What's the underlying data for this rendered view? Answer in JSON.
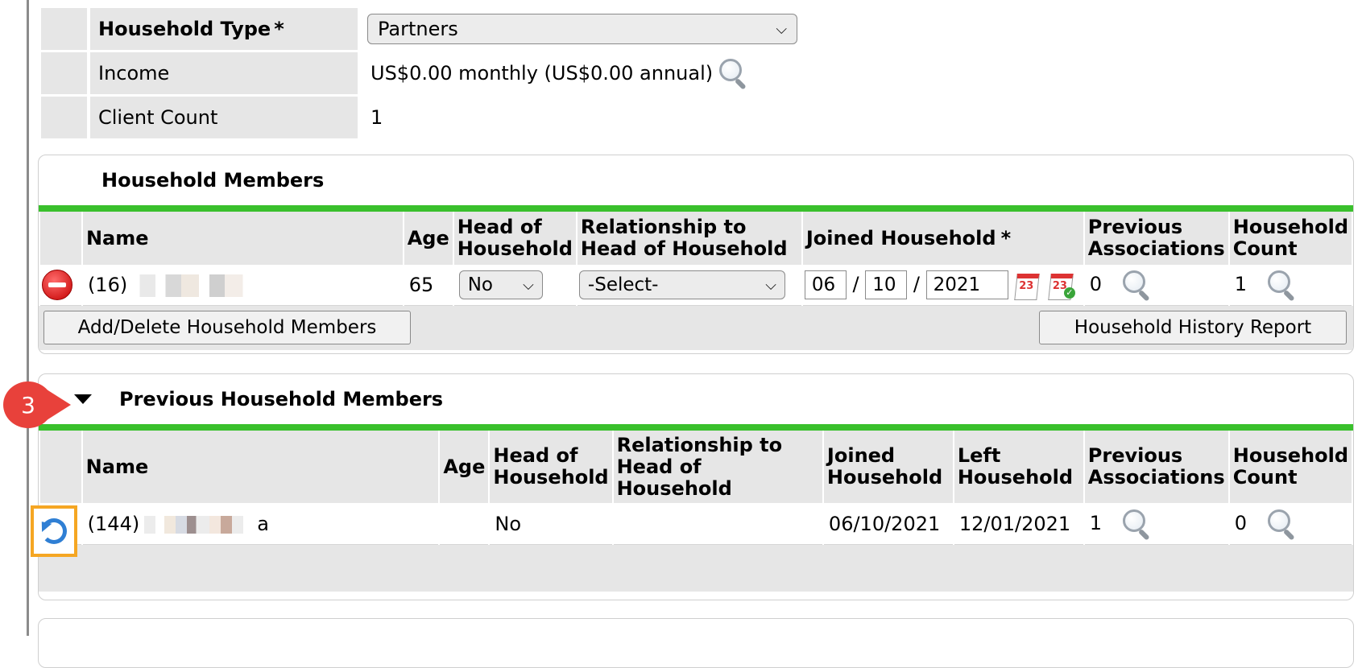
{
  "info": {
    "household_type_label": "Household Type",
    "required_mark": "*",
    "household_type_value": "Partners",
    "income_label": "Income",
    "income_value": "US$0.00 monthly (US$0.00 annual)",
    "client_count_label": "Client Count",
    "client_count_value": "1"
  },
  "household_members": {
    "title": "Household Members",
    "headers": {
      "name": "Name",
      "age": "Age",
      "head1": "Head of",
      "head2": "Household",
      "rel1": "Relationship to",
      "rel2": "Head of Household",
      "joined": "Joined Household",
      "prev1": "Previous",
      "prev2": "Associations",
      "count1": "Household",
      "count2": "Count"
    },
    "row": {
      "name": "(16)",
      "age": "65",
      "head_value": "No",
      "relationship_value": "-Select-",
      "date_month": "06",
      "date_day": "10",
      "date_year": "2021",
      "date_sep": "/",
      "previous": "0",
      "count": "1"
    },
    "add_delete_button": "Add/Delete Household Members",
    "history_button": "Household History Report"
  },
  "previous_members": {
    "badge": "3",
    "title": "Previous Household Members",
    "headers": {
      "name": "Name",
      "age": "Age",
      "head1": "Head of",
      "head2": "Household",
      "rel1": "Relationship to",
      "rel2": "Head of",
      "rel3": "Household",
      "joined1": "Joined",
      "joined2": "Household",
      "left1": "Left",
      "left2": "Household",
      "prev1": "Previous",
      "prev2": "Associations",
      "count1": "Household",
      "count2": "Count"
    },
    "row": {
      "name": "(144)",
      "name_tail": "a",
      "age": "",
      "head_value": "No",
      "relationship": "",
      "joined": "06/10/2021",
      "left": "12/01/2021",
      "previous": "1",
      "count": "0"
    }
  },
  "colors": {
    "accent_green": "#39c02c",
    "badge_red": "#e8413b",
    "highlight_orange": "#f5a623"
  }
}
